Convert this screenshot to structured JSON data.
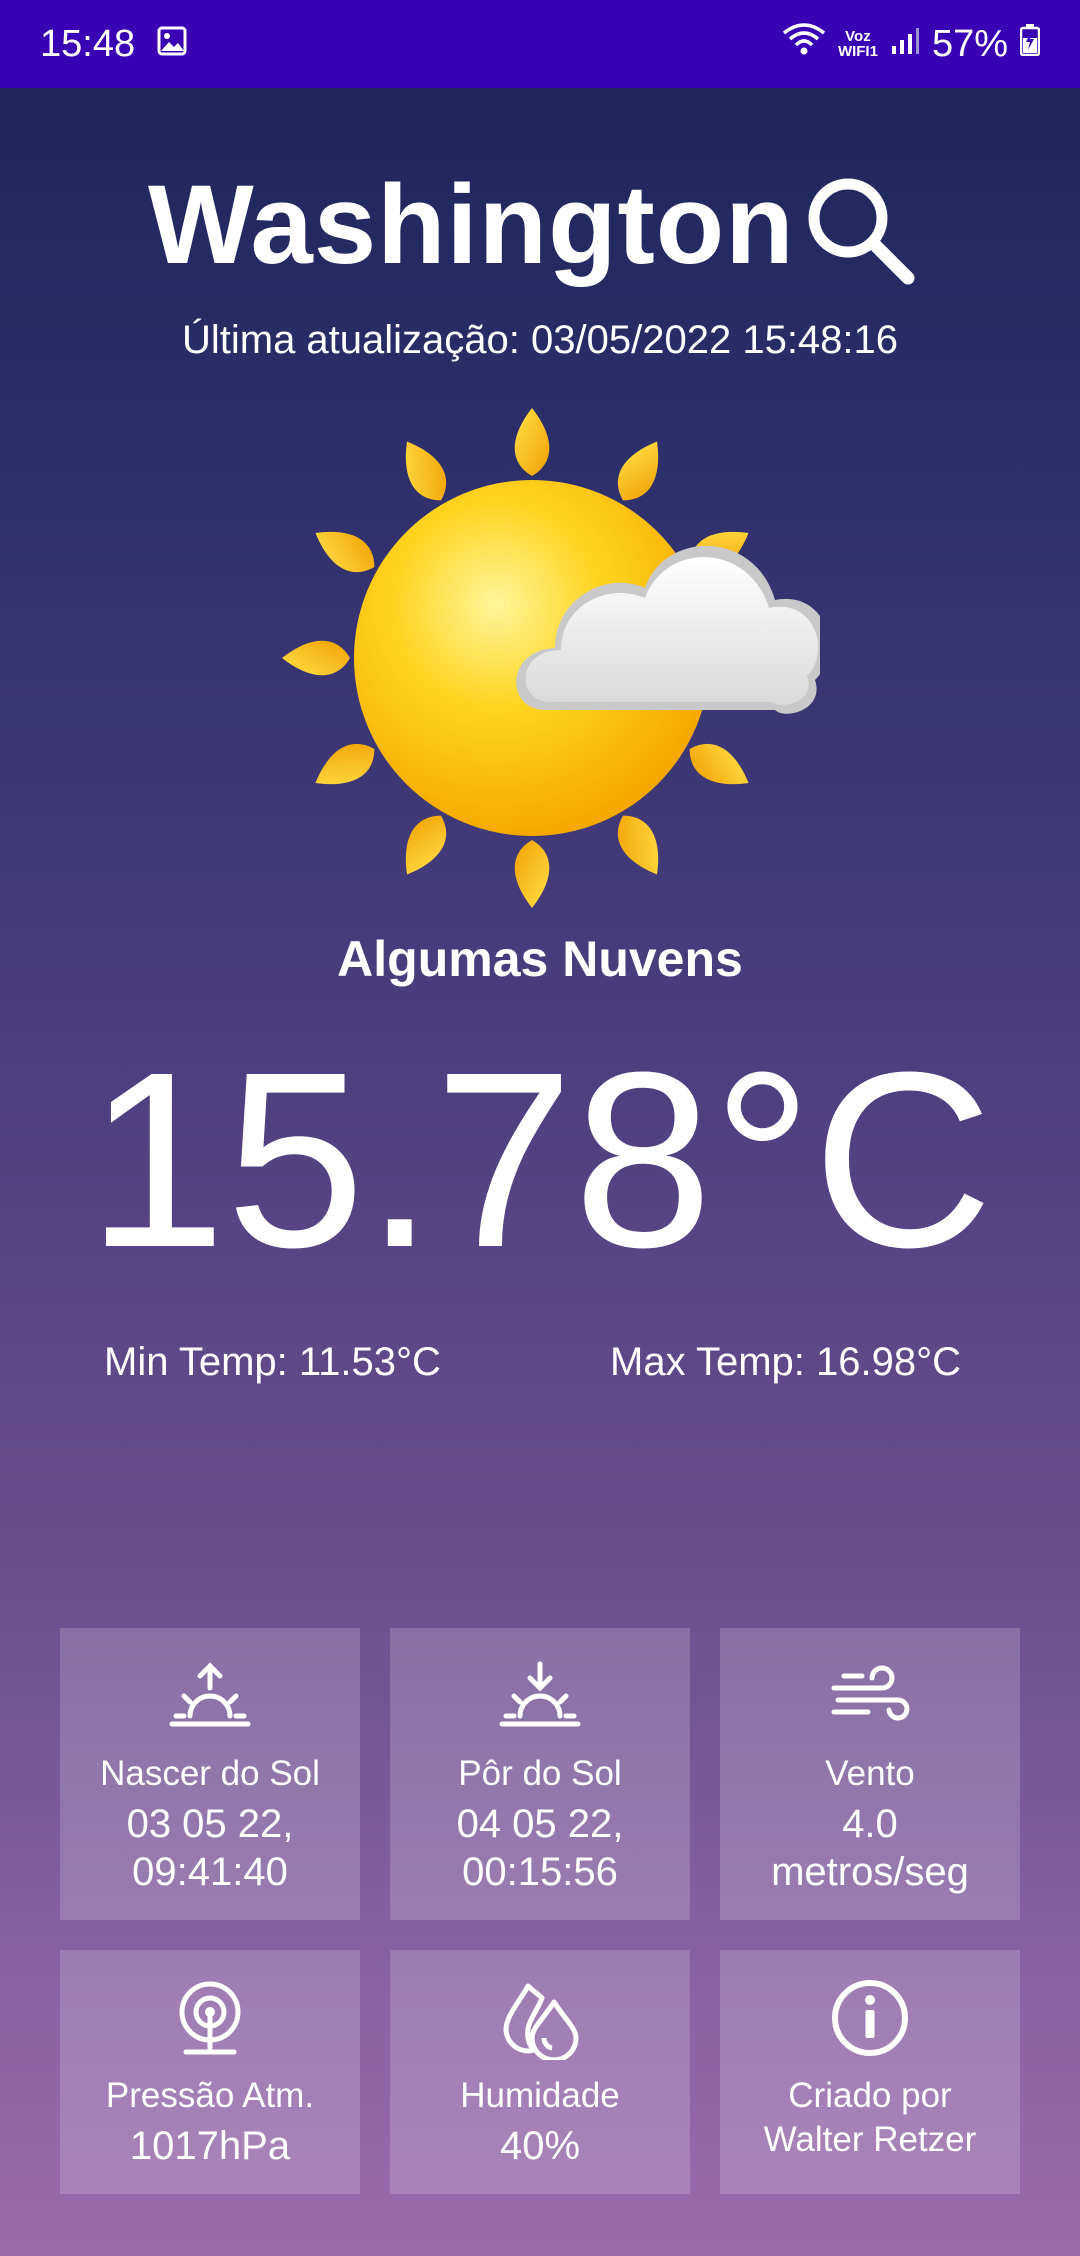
{
  "status_bar": {
    "time": "15:48",
    "network_label_top": "Voz",
    "network_label_bottom": "WIFI1",
    "battery": "57%"
  },
  "header": {
    "city": "Washington",
    "last_update": "Última atualização: 03/05/2022 15:48:16"
  },
  "current": {
    "icon": "sun-with-cloud-icon",
    "condition": "Algumas Nuvens",
    "temperature": "15.78°C",
    "min_temp": "Min Temp: 11.53°C",
    "max_temp": "Max Temp: 16.98°C"
  },
  "details": [
    {
      "icon": "sunrise-icon",
      "label": "Nascer do Sol",
      "value_line1": "03 05 22,",
      "value_line2": "09:41:40"
    },
    {
      "icon": "sunset-icon",
      "label": "Pôr do Sol",
      "value_line1": "04 05 22,",
      "value_line2": "00:15:56"
    },
    {
      "icon": "wind-icon",
      "label": "Vento",
      "value_line1": "4.0",
      "value_line2": "metros/seg"
    },
    {
      "icon": "pressure-icon",
      "label": "Pressão Atm.",
      "value_line1": "1017hPa"
    },
    {
      "icon": "humidity-icon",
      "label": "Humidade",
      "value_line1": "40%"
    },
    {
      "icon": "info-icon",
      "label": "Criado por",
      "value_line1": "Walter Retzer"
    }
  ],
  "colors": {
    "status_bar": "#3a00b4",
    "sun": "#ffc21a",
    "cloud": "#f2f2f2"
  }
}
